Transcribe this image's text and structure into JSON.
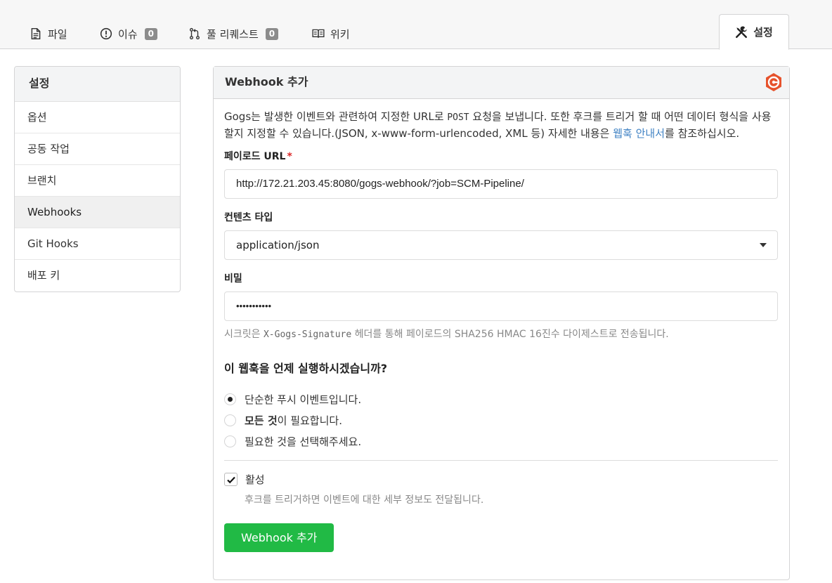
{
  "tabs": {
    "files": "파일",
    "issues": "이슈",
    "issues_count": "0",
    "pulls": "풀 리퀘스트",
    "pulls_count": "0",
    "wiki": "위키",
    "settings": "설정"
  },
  "sidebar": {
    "title": "설정",
    "items": [
      {
        "label": "옵션"
      },
      {
        "label": "공동 작업"
      },
      {
        "label": "브랜치"
      },
      {
        "label": "Webhooks"
      },
      {
        "label": "Git Hooks"
      },
      {
        "label": "배포 키"
      }
    ],
    "active_index": 3
  },
  "panel": {
    "title": "Webhook 추가",
    "desc_part1": "Gogs는 발생한 이벤트와 관련하여 지정한 URL로 ",
    "desc_post": "POST",
    "desc_part2": " 요청을 보냅니다. 또한 후크를 트리거 할 때 어떤 데이터 형식을 사용할지 지정할 수 있습니다.(JSON, x-www-form-urlencoded, XML 등) 자세한 내용은 ",
    "desc_link": "웹훅 안내서",
    "desc_part3": "를 참조하십시오.",
    "payload_label": "페이로드 URL",
    "payload_required_mark": "*",
    "payload_value": "http://172.21.203.45:8080/gogs-webhook/?job=SCM-Pipeline/",
    "content_type_label": "컨텐츠 타입",
    "content_type_value": "application/json",
    "secret_label": "비밀",
    "secret_value": "•••••••••••",
    "secret_help_part1": "시크릿은 ",
    "secret_help_code": "X-Gogs-Signature",
    "secret_help_part2": " 헤더를 통해 페이로드의 SHA256 HMAC 16진수 다이제스트로 전송됩니다.",
    "question": "이 웹훅을 언제 실행하시겠습니까?",
    "radio_push": "단순한 푸시 이벤트입니다.",
    "radio_all_bold": "모든 것",
    "radio_all_rest": "이 필요합니다.",
    "radio_choose": "필요한 것을 선택해주세요.",
    "active_label": "활성",
    "active_help": "후크를 트리거하면 이벤트에 대한 세부 정보도 전달됩니다.",
    "submit_label": "Webhook 추가"
  },
  "colors": {
    "submit_bg": "#21ba45",
    "link": "#4183c4",
    "required": "#db2828",
    "logo": "#e6522c"
  }
}
